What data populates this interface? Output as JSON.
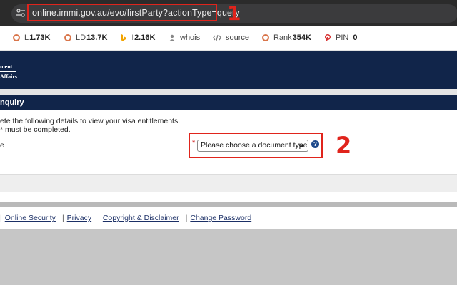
{
  "browser": {
    "url": "online.immi.gov.au/evo/firstParty?actionType=query"
  },
  "annotations": {
    "marker_1": "1",
    "marker_2": "2",
    "color": "#e0241c"
  },
  "seo_toolbar": {
    "items": [
      {
        "label": "L",
        "value": "1.73K",
        "icon": "semrush-ring-icon"
      },
      {
        "label": "LD",
        "value": "13.7K",
        "icon": "semrush-ring-icon"
      },
      {
        "label": "I",
        "value": "2.16K",
        "icon": "bing-icon"
      },
      {
        "label": "whois",
        "value": "",
        "icon": "person-icon"
      },
      {
        "label": "source",
        "value": "",
        "icon": "code-icon"
      },
      {
        "label": "Rank",
        "value": "354K",
        "icon": "semrush-ring-icon"
      },
      {
        "label": "PIN",
        "value": "0",
        "icon": "pinterest-icon"
      }
    ]
  },
  "header": {
    "logo_line1": "ment",
    "logo_line2": "Affairs",
    "color": "#11254a"
  },
  "section": {
    "title": "nquiry"
  },
  "form": {
    "instruction_1": "ete the following details to view your visa entitlements.",
    "instruction_2": "* must be completed.",
    "row_label": "e",
    "required_mark": "*",
    "document_type_selected": "Please choose a document type",
    "help_glyph": "?"
  },
  "footer": {
    "links": [
      "Online Security",
      "Privacy",
      "Copyright & Disclaimer",
      "Change Password"
    ],
    "separator": "|"
  }
}
